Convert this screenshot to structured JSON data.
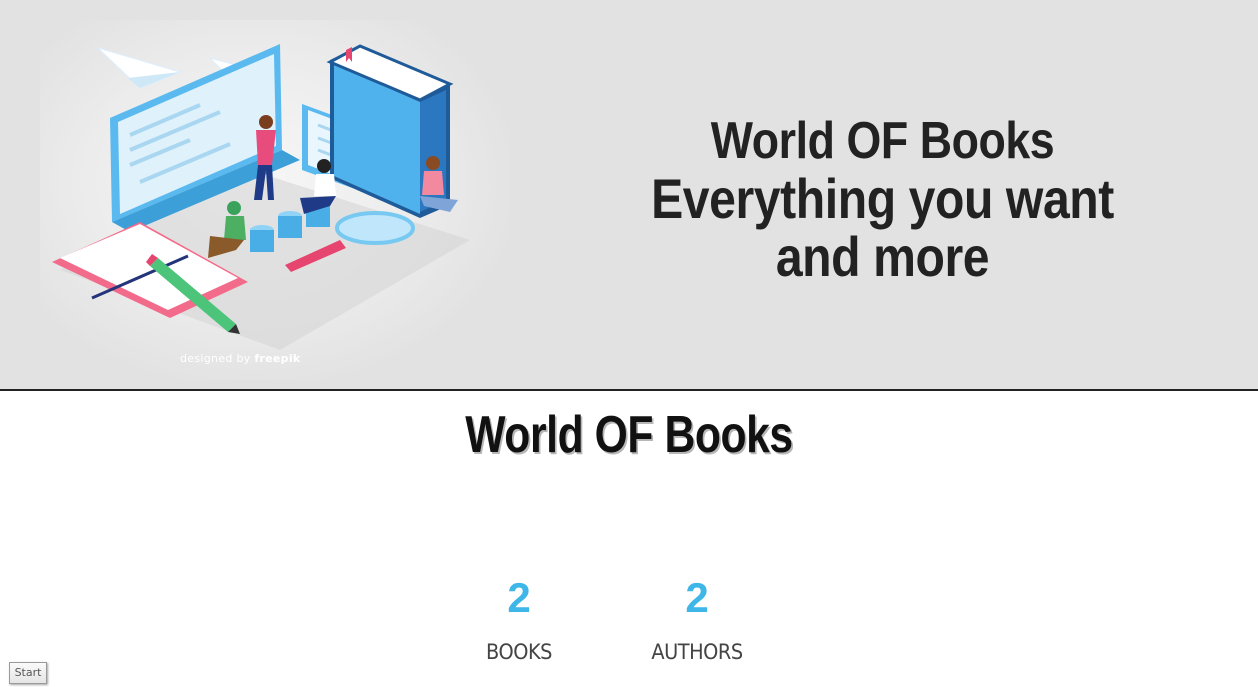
{
  "hero": {
    "title": "World OF Books",
    "subtitle": "Everything you want and more",
    "credit_prefix": "designed by",
    "credit_brand": "freepik"
  },
  "section": {
    "title": "World OF Books"
  },
  "stats": [
    {
      "value": "2",
      "label": "BOOKS"
    },
    {
      "value": "2",
      "label": "AUTHORS"
    }
  ],
  "start_button": {
    "label": "Start"
  },
  "colors": {
    "hero_background": "#e2e2e2",
    "stat_accent": "#3eb6e8",
    "heading": "#222222"
  },
  "icons": [
    "library-illustration",
    "paper-plane-icon",
    "monitor-icon",
    "book-stack-icon",
    "pencil-icon",
    "magnifier-icon"
  ]
}
